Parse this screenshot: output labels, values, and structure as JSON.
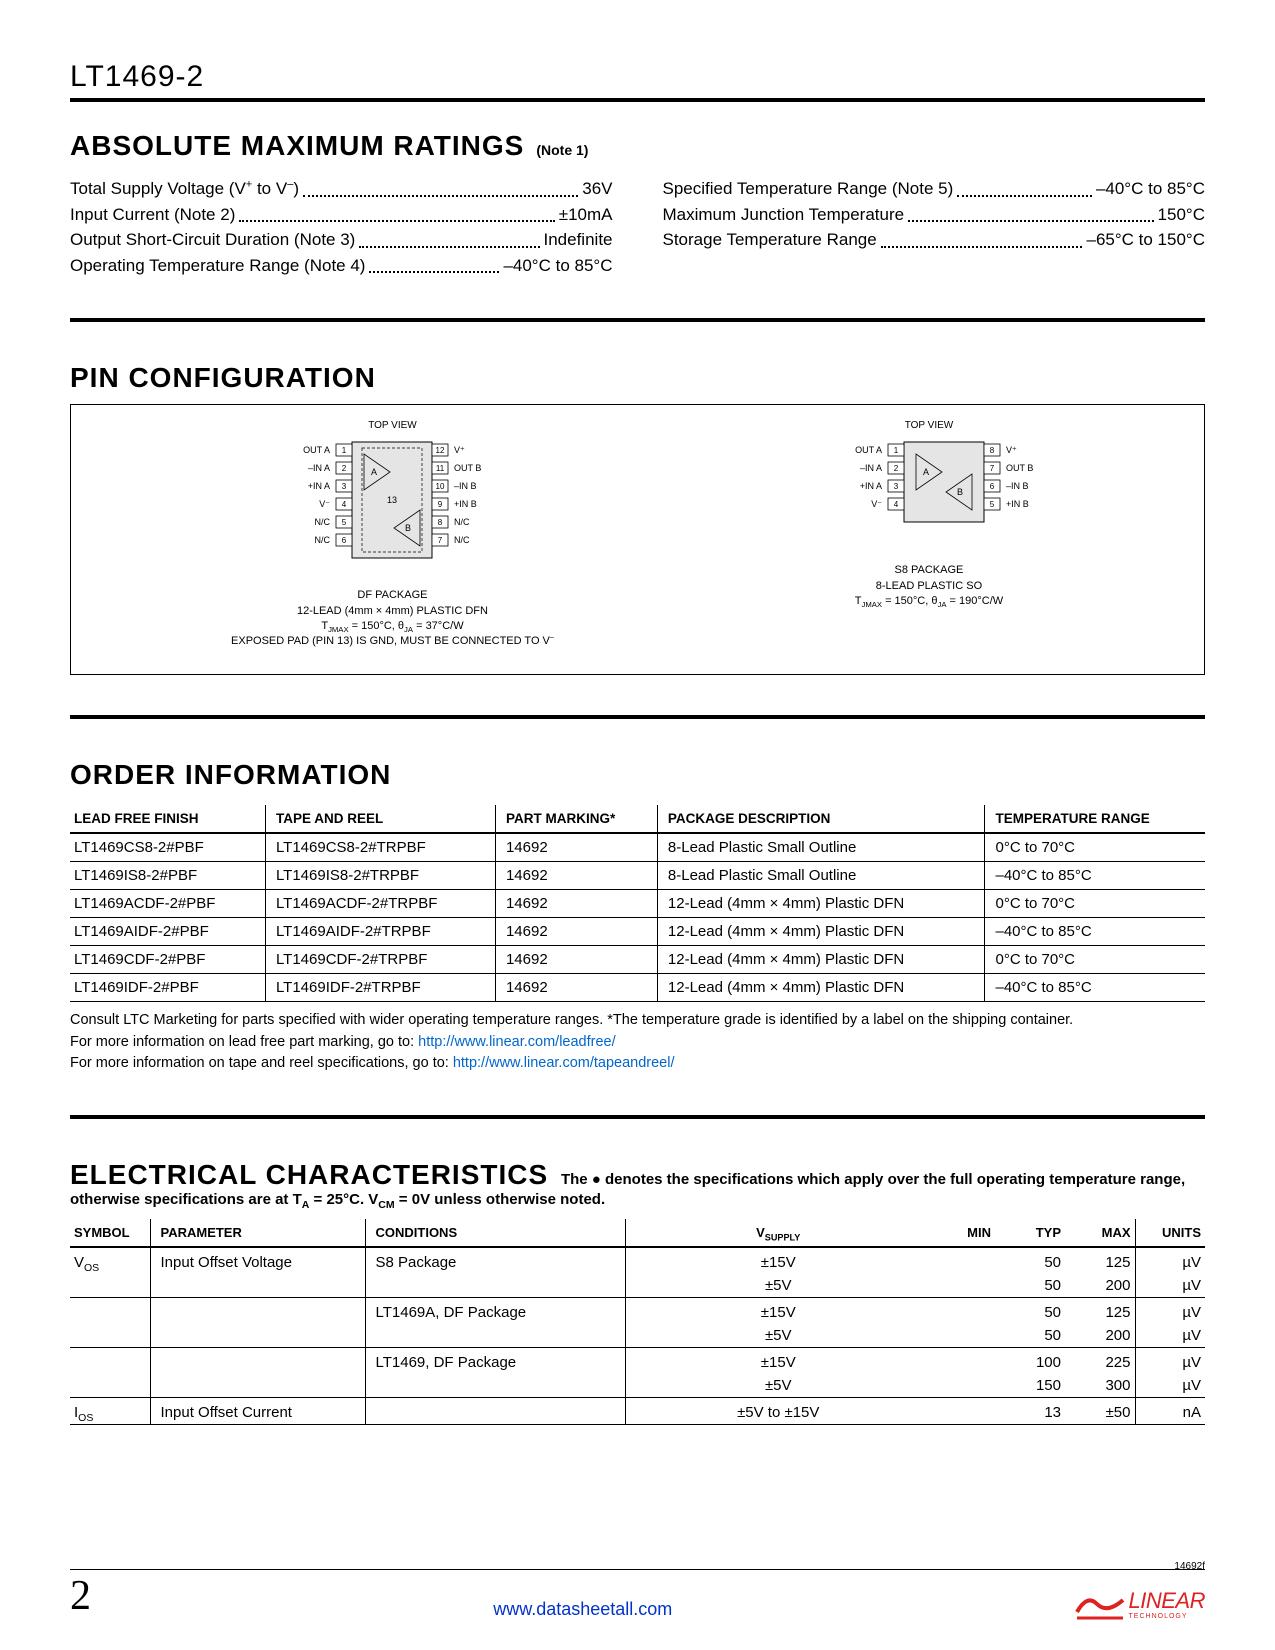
{
  "header": {
    "part_number": "LT1469-2"
  },
  "amr": {
    "heading": "ABSOLUTE MAXIMUM RATINGS",
    "note_suffix": "(Note 1)",
    "rows_left": [
      {
        "label": "Total Supply Voltage (V<sup>+</sup> to V<sup>–</sup>)",
        "value": "36V"
      },
      {
        "label": "Input Current (Note 2)",
        "value": "±10mA"
      },
      {
        "label": "Output Short-Circuit Duration (Note 3)",
        "value": "Indefinite"
      },
      {
        "label": "Operating Temperature Range (Note 4)",
        "value": "–40°C to 85°C"
      }
    ],
    "rows_right": [
      {
        "label": "Specified Temperature Range (Note 5)",
        "value": "–40°C to 85°C"
      },
      {
        "label": "Maximum Junction Temperature",
        "value": "150°C"
      },
      {
        "label": "Storage Temperature Range",
        "value": "–65°C to 150°C"
      }
    ]
  },
  "pin": {
    "heading": "PIN CONFIGURATION",
    "topview": "TOP VIEW",
    "df": {
      "left_pins": [
        {
          "n": "1",
          "l": "OUT A"
        },
        {
          "n": "2",
          "l": "–IN A"
        },
        {
          "n": "3",
          "l": "+IN A"
        },
        {
          "n": "4",
          "l": "V–"
        },
        {
          "n": "5",
          "l": "N/C"
        },
        {
          "n": "6",
          "l": "N/C"
        }
      ],
      "right_pins": [
        {
          "n": "12",
          "l": "V+"
        },
        {
          "n": "11",
          "l": "OUT B"
        },
        {
          "n": "10",
          "l": "–IN B"
        },
        {
          "n": "9",
          "l": "+IN B"
        },
        {
          "n": "8",
          "l": "N/C"
        },
        {
          "n": "7",
          "l": "N/C"
        }
      ],
      "center_pin": "13",
      "amps": [
        "A",
        "B"
      ],
      "caption_line1": "DF PACKAGE",
      "caption_line2": "12-LEAD (4mm × 4mm) PLASTIC DFN",
      "caption_line3": "TJMAX = 150°C, θJA = 37°C/W",
      "caption_line4": "EXPOSED PAD (PIN 13) IS GND, MUST BE CONNECTED TO V–"
    },
    "s8": {
      "left_pins": [
        {
          "n": "1",
          "l": "OUT A"
        },
        {
          "n": "2",
          "l": "–IN A"
        },
        {
          "n": "3",
          "l": "+IN A"
        },
        {
          "n": "4",
          "l": "V–"
        }
      ],
      "right_pins": [
        {
          "n": "8",
          "l": "V+"
        },
        {
          "n": "7",
          "l": "OUT B"
        },
        {
          "n": "6",
          "l": "–IN B"
        },
        {
          "n": "5",
          "l": "+IN B"
        }
      ],
      "amps": [
        "A",
        "B"
      ],
      "caption_line1": "S8 PACKAGE",
      "caption_line2": "8-LEAD PLASTIC SO",
      "caption_line3": "TJMAX = 150°C, θJA = 190°C/W"
    }
  },
  "order": {
    "heading": "ORDER INFORMATION",
    "columns": [
      "LEAD FREE FINISH",
      "TAPE AND REEL",
      "PART MARKING*",
      "PACKAGE DESCRIPTION",
      "TEMPERATURE RANGE"
    ],
    "rows": [
      [
        "LT1469CS8-2#PBF",
        "LT1469CS8-2#TRPBF",
        "14692",
        "8-Lead Plastic Small Outline",
        "0°C to 70°C"
      ],
      [
        "LT1469IS8-2#PBF",
        "LT1469IS8-2#TRPBF",
        "14692",
        "8-Lead Plastic Small Outline",
        "–40°C to 85°C"
      ],
      [
        "LT1469ACDF-2#PBF",
        "LT1469ACDF-2#TRPBF",
        "14692",
        "12-Lead (4mm × 4mm) Plastic DFN",
        "0°C to 70°C"
      ],
      [
        "LT1469AIDF-2#PBF",
        "LT1469AIDF-2#TRPBF",
        "14692",
        "12-Lead (4mm × 4mm) Plastic DFN",
        "–40°C to 85°C"
      ],
      [
        "LT1469CDF-2#PBF",
        "LT1469CDF-2#TRPBF",
        "14692",
        "12-Lead (4mm × 4mm) Plastic DFN",
        "0°C to 70°C"
      ],
      [
        "LT1469IDF-2#PBF",
        "LT1469IDF-2#TRPBF",
        "14692",
        "12-Lead (4mm × 4mm) Plastic DFN",
        "–40°C to 85°C"
      ]
    ],
    "note1": "Consult LTC Marketing for parts specified with wider operating temperature ranges.  *The temperature grade is identified by a label on the shipping container.",
    "note2_prefix": "For more information on lead free part marking, go to: ",
    "note2_link": "http://www.linear.com/leadfree/",
    "note3_prefix": "For more information on tape and reel specifications, go to: ",
    "note3_link": "http://www.linear.com/tapeandreel/"
  },
  "ec": {
    "heading": "ELECTRICAL CHARACTERISTICS",
    "subtitle": "The ● denotes the specifications which apply over the full operating temperature range, otherwise specifications are at TA = 25°C. VCM = 0V unless otherwise noted.",
    "columns": [
      "SYMBOL",
      "PARAMETER",
      "CONDITIONS",
      "VSUPPLY",
      "MIN",
      "TYP",
      "MAX",
      "UNITS"
    ],
    "rows": [
      {
        "sym": "VOS",
        "param": "Input Offset Voltage",
        "cond": "S8 Package",
        "vs": [
          "±15V",
          "±5V"
        ],
        "min": [
          "",
          ""
        ],
        "typ": [
          "50",
          "50"
        ],
        "max": [
          "125",
          "200"
        ],
        "u": [
          "µV",
          "µV"
        ],
        "top": true
      },
      {
        "sym": "",
        "param": "",
        "cond": "LT1469A, DF Package",
        "vs": [
          "±15V",
          "±5V"
        ],
        "min": [
          "",
          ""
        ],
        "typ": [
          "50",
          "50"
        ],
        "max": [
          "125",
          "200"
        ],
        "u": [
          "µV",
          "µV"
        ],
        "top": true
      },
      {
        "sym": "",
        "param": "",
        "cond": "LT1469, DF Package",
        "vs": [
          "±15V",
          "±5V"
        ],
        "min": [
          "",
          ""
        ],
        "typ": [
          "100",
          "150"
        ],
        "max": [
          "225",
          "300"
        ],
        "u": [
          "µV",
          "µV"
        ],
        "top": true
      },
      {
        "sym": "IOS",
        "param": "Input Offset Current",
        "cond": "",
        "vs": [
          "±5V to ±15V"
        ],
        "min": [
          ""
        ],
        "typ": [
          "13"
        ],
        "max": [
          "±50"
        ],
        "u": [
          "nA"
        ],
        "top": true
      }
    ]
  },
  "footer": {
    "doc_rev": "14692f",
    "page_number": "2",
    "link": "www.datasheetall.com",
    "logo_text": "LINEAR",
    "logo_sub": "TECHNOLOGY"
  }
}
